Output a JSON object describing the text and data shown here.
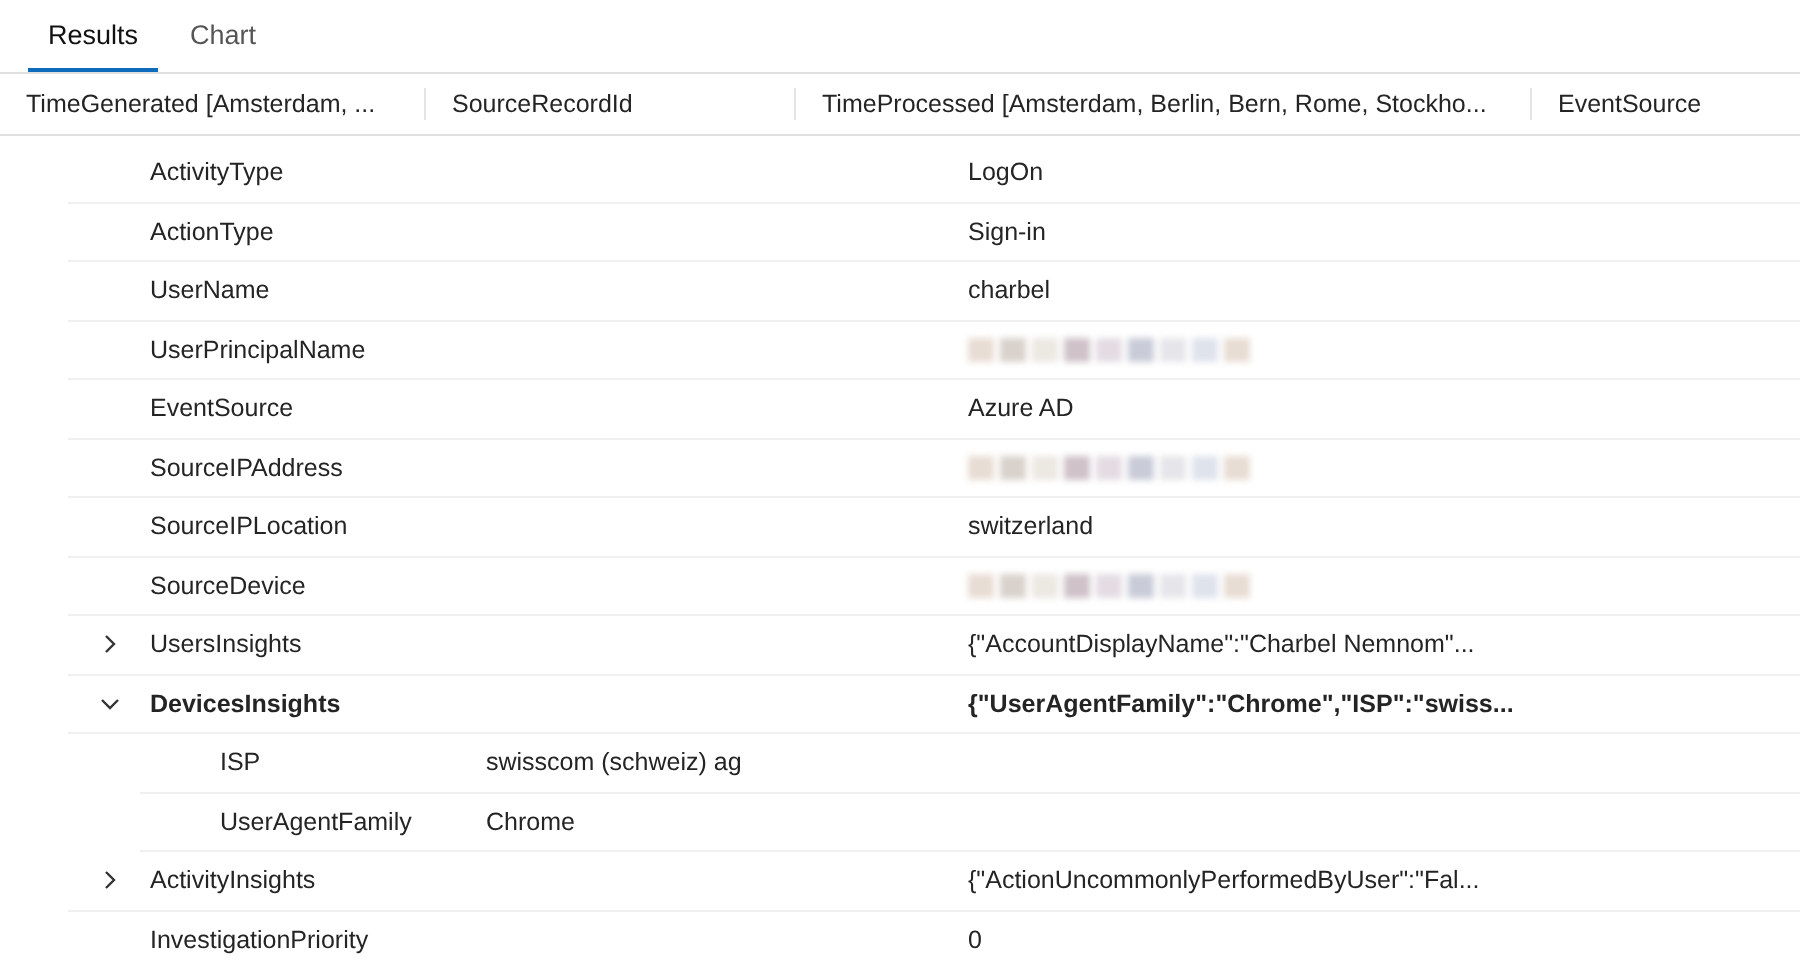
{
  "tabs": [
    {
      "label": "Results",
      "selected": true
    },
    {
      "label": "Chart",
      "selected": false
    }
  ],
  "table": {
    "columns": [
      "TimeGenerated [Amsterdam, ...",
      "SourceRecordId",
      "TimeProcessed [Amsterdam, Berlin, Bern, Rome, Stockho...",
      "EventSource"
    ],
    "rows": [
      {
        "name": "ActivityType",
        "kind": "text",
        "value": "LogOn"
      },
      {
        "name": "ActionType",
        "kind": "text",
        "value": "Sign-in"
      },
      {
        "name": "UserName",
        "kind": "text",
        "value": "charbel"
      },
      {
        "name": "UserPrincipalName",
        "kind": "redacted"
      },
      {
        "name": "EventSource",
        "kind": "text",
        "value": "Azure AD"
      },
      {
        "name": "SourceIPAddress",
        "kind": "redacted"
      },
      {
        "name": "SourceIPLocation",
        "kind": "text",
        "value": "switzerland"
      },
      {
        "name": "SourceDevice",
        "kind": "redacted"
      },
      {
        "name": "UsersInsights",
        "kind": "text",
        "value": "{\"AccountDisplayName\":\"Charbel Nemnom\"...",
        "expanded": false
      },
      {
        "name": "DevicesInsights",
        "kind": "text",
        "value": "{\"UserAgentFamily\":\"Chrome\",\"ISP\":\"swiss...",
        "expanded": true,
        "children": [
          {
            "name": "ISP",
            "kind": "text",
            "value": "swisscom (schweiz) ag"
          },
          {
            "name": "UserAgentFamily",
            "kind": "text",
            "value": "Chrome"
          }
        ]
      },
      {
        "name": "ActivityInsights",
        "kind": "text",
        "value": "{\"ActionUncommonlyPerformedByUser\":\"Fal...",
        "expanded": false
      },
      {
        "name": "InvestigationPriority",
        "kind": "text",
        "value": "0"
      }
    ]
  }
}
